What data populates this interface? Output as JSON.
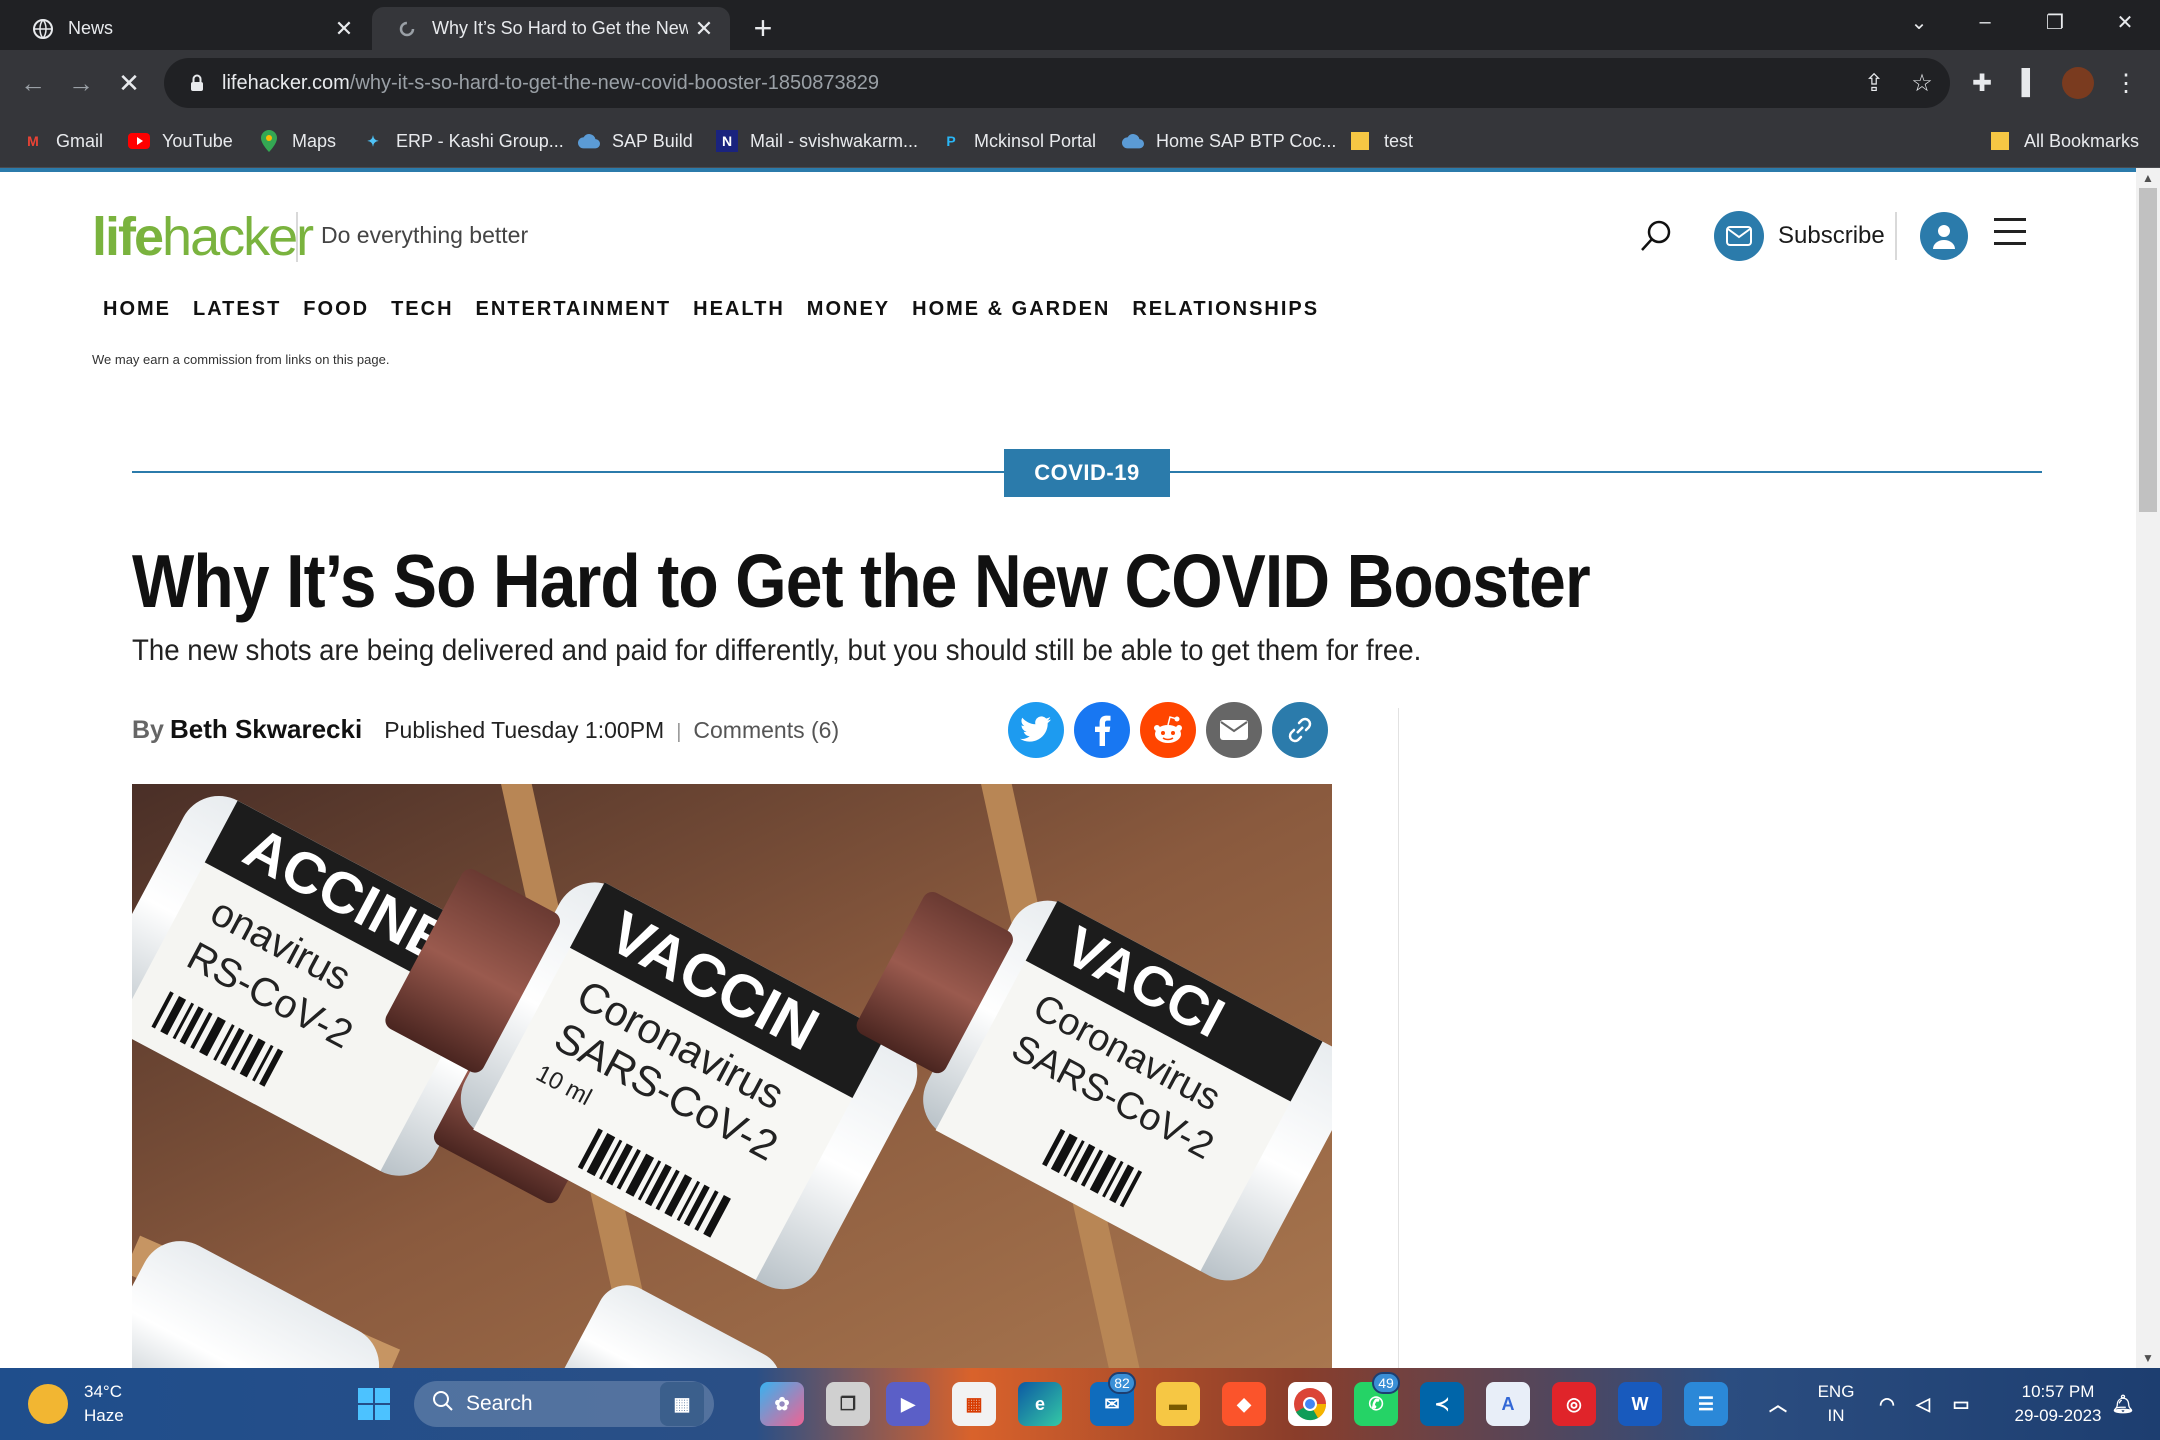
{
  "browser": {
    "tabs": [
      {
        "title": "News",
        "active": false
      },
      {
        "title": "Why It’s So Hard to Get the New",
        "active": true
      }
    ],
    "url_host": "lifehacker.com",
    "url_path": "/why-it-s-so-hard-to-get-the-new-covid-booster-1850873829",
    "bookmarks": [
      "Gmail",
      "YouTube",
      "Maps",
      "ERP - Kashi Group...",
      "SAP Build",
      "Mail - svishwakarm...",
      "Mckinsol Portal",
      "Home SAP BTP Coc...",
      "test"
    ],
    "all_bookmarks": "All Bookmarks"
  },
  "site": {
    "logo_life": "life",
    "logo_hacker": "hacker",
    "tagline": "Do everything better",
    "subscribe_label": "Subscribe",
    "nav": [
      "HOME",
      "LATEST",
      "FOOD",
      "TECH",
      "ENTERTAINMENT",
      "HEALTH",
      "MONEY",
      "HOME & GARDEN",
      "RELATIONSHIPS"
    ],
    "commission_note": "We may earn a commission from links on this page.",
    "accent_color": "#2b7bab",
    "logo_color": "#7ab33e"
  },
  "article": {
    "category": "COVID-19",
    "headline": "Why It’s So Hard to Get the New COVID Booster",
    "dek": "The new shots are being delivered and paid for differently, but you should still be able to get them for free.",
    "by": "By",
    "author": "Beth Skwarecki",
    "published": "Published Tuesday 1:00PM",
    "comments": "Comments (6)",
    "share_icons": [
      "twitter-icon",
      "facebook-icon",
      "reddit-icon",
      "email-icon",
      "link-icon"
    ],
    "image_labels": {
      "vial_left": [
        "ACCINE",
        "onavirus",
        "RS-CoV-2"
      ],
      "vial_center": [
        "VACCIN",
        "Coronavirus",
        "SARS-CoV-2",
        "10 ml"
      ],
      "vial_right": [
        "VACCI",
        "Coronavirus",
        "SARS-CoV-2"
      ]
    }
  },
  "taskbar": {
    "temperature": "34°C",
    "condition": "Haze",
    "search_placeholder": "Search",
    "badge_mail": "82",
    "badge_whatsapp": "49",
    "lang_top": "ENG",
    "lang_bottom": "IN",
    "time": "10:57 PM",
    "date": "29-09-2023"
  }
}
